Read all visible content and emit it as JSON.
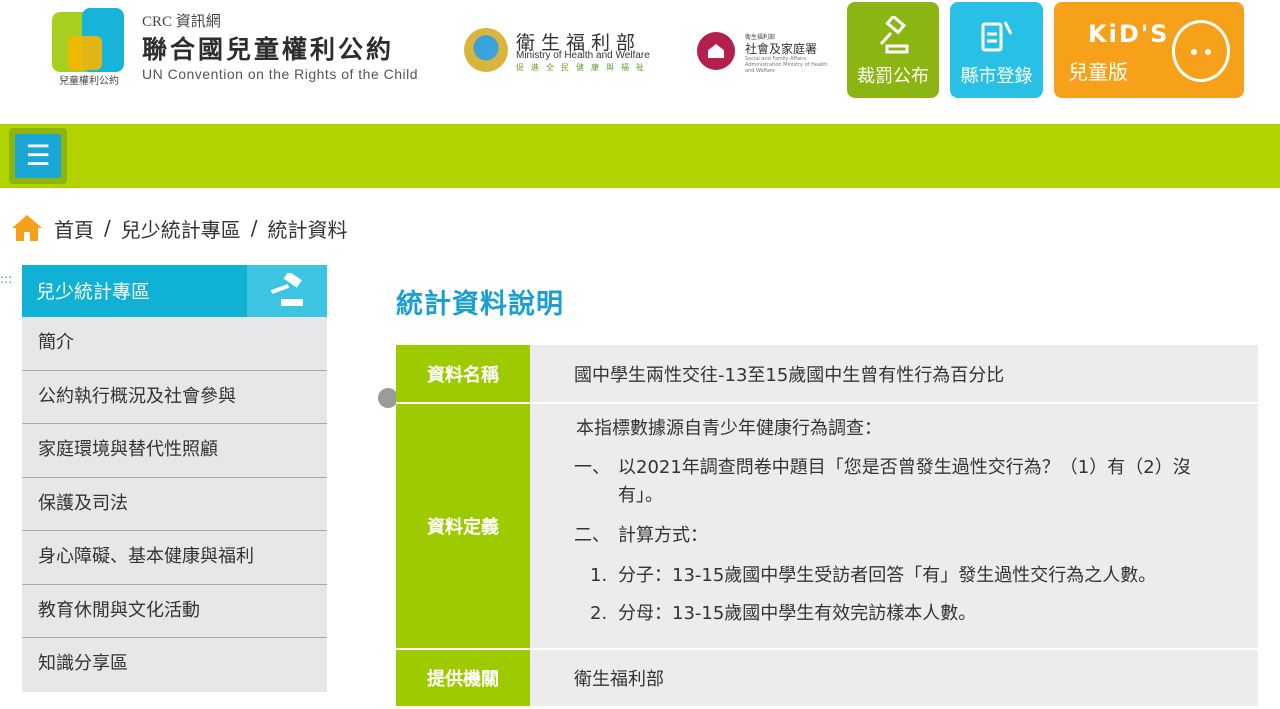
{
  "header": {
    "logo_caption": "兒童權利公約",
    "site_small": "CRC 資訊網",
    "site_title": "聯合國兒童權利公約",
    "site_en": "UN Convention on the Rights of the Child",
    "mohw_zh": "衛生福利部",
    "mohw_en": "Ministry of Health and Welfare",
    "mohw_sub": "促進全民健康與福祉",
    "sfaa_top": "衛生福利部",
    "sfaa_zh": "社會及家庭署",
    "sfaa_en": "Social and Family Affairs Administration Ministry of Health and Welfare",
    "buttons": {
      "judge": "裁罰公布",
      "city": "縣市登錄",
      "kids_word": "KiD'S",
      "kids_sub": "兒童版"
    },
    "colors": {
      "green": "#8bb512",
      "blue": "#29c0e6",
      "orange": "#f7a11a"
    }
  },
  "nav": {
    "menu_icon": "☰",
    "bar_color": "#b1d300"
  },
  "breadcrumb": {
    "home": "首頁",
    "separator": "/",
    "level1": "兒少統計專區",
    "level2": "統計資料"
  },
  "sidebar": {
    "dots": ":::",
    "title": "兒少統計專區",
    "items": [
      {
        "label": "簡介"
      },
      {
        "label": "公約執行概況及社會參與"
      },
      {
        "label": "家庭環境與替代性照顧"
      },
      {
        "label": "保護及司法"
      },
      {
        "label": "身心障礙、基本健康與福利"
      },
      {
        "label": "教育休閒與文化活動"
      },
      {
        "label": "知識分享區"
      }
    ]
  },
  "main": {
    "title": "統計資料說明",
    "rows": {
      "name": {
        "label": "資料名稱",
        "value": "國中學生兩性交往-13至15歲國中生曾有性行為百分比"
      },
      "definition": {
        "label": "資料定義",
        "intro": "本指標數據源自青少年健康行為調查：",
        "items": [
          {
            "num": "一、",
            "text": "以2021年調查問卷中題目「您是否曾發生過性交行為？（1）有（2）沒有」。"
          },
          {
            "num": "二、",
            "text": "計算方式："
          }
        ],
        "sub_items": [
          {
            "num": "1.",
            "text": "分子：13-15歲國中學生受訪者回答「有」發生過性交行為之人數。"
          },
          {
            "num": "2.",
            "text": "分母：13-15歲國中學生有效完訪樣本人數。"
          }
        ]
      },
      "org": {
        "label": "提供機關",
        "value": "衛生福利部"
      }
    }
  }
}
